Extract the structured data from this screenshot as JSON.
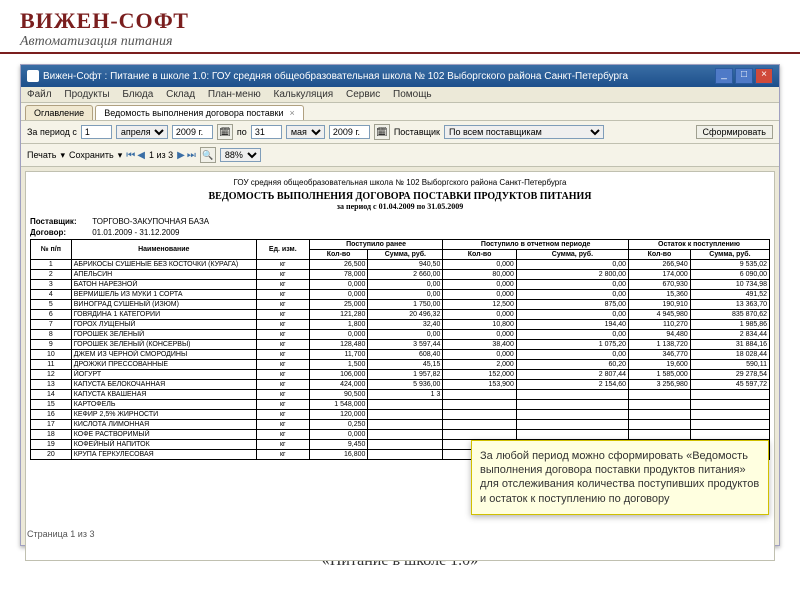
{
  "brand": {
    "title": "ВИЖЕН-СОФТ",
    "subtitle": "Автоматизация питания"
  },
  "window": {
    "title": "Вижен-Софт : Питание в школе 1.0: ГОУ средняя общеобразовательная школа № 102 Выборгского района Санкт-Петербурга"
  },
  "menu": [
    "Файл",
    "Продукты",
    "Блюда",
    "Склад",
    "План-меню",
    "Калькуляция",
    "Сервис",
    "Помощь"
  ],
  "tabs": {
    "first": "Оглавление",
    "second": "Ведомость выполнения договора поставки"
  },
  "period": {
    "label": "За период с",
    "from_day": "1",
    "from_month": "апреля",
    "from_year": "2009 г.",
    "to": "по",
    "to_day": "31",
    "to_month": "мая",
    "to_year": "2009 г."
  },
  "supplier": {
    "label": "Поставщик",
    "value": "По всем поставщикам",
    "button": "Сформировать"
  },
  "toolbar2": {
    "print": "Печать",
    "save": "Сохранить",
    "pages": "1 из 3",
    "zoom": "88%"
  },
  "report": {
    "org": "ГОУ средняя общеобразовательная школа № 102 Выборгского района Санкт-Петербурга",
    "title": "ВЕДОМОСТЬ ВЫПОЛНЕНИЯ ДОГОВОРА ПОСТАВКИ ПРОДУКТОВ ПИТАНИЯ",
    "period_line": "за период с 01.04.2009 по 31.05.2009",
    "supplier_label": "Поставщик:",
    "supplier": "ТОРГОВО-ЗАКУПОЧНАЯ БАЗА",
    "contract_label": "Договор:",
    "contract": "01.01.2009 - 31.12.2009",
    "headers": {
      "num": "№ п/п",
      "name": "Наименование",
      "unit": "Ед. изм.",
      "g1": "Поступило ранее",
      "g2": "Поступило в отчетном периоде",
      "g3": "Остаток к поступлению",
      "qty": "Кол-во",
      "sum": "Сумма, руб."
    },
    "rows": [
      {
        "n": 1,
        "name": "АБРИКОСЫ СУШЕНЫЕ БЕЗ КОСТОЧКИ (КУРАГА)",
        "u": "кг",
        "q1": "26,500",
        "s1": "940,50",
        "q2": "0,000",
        "s2": "0,00",
        "q3": "266,940",
        "s3": "9 535,02"
      },
      {
        "n": 2,
        "name": "АПЕЛЬСИН",
        "u": "кг",
        "q1": "78,000",
        "s1": "2 660,00",
        "q2": "80,000",
        "s2": "2 800,00",
        "q3": "174,000",
        "s3": "6 090,00"
      },
      {
        "n": 3,
        "name": "БАТОН НАРЕЗНОЙ",
        "u": "кг",
        "q1": "0,000",
        "s1": "0,00",
        "q2": "0,000",
        "s2": "0,00",
        "q3": "670,930",
        "s3": "10 734,98"
      },
      {
        "n": 4,
        "name": "ВЕРМИШЕЛЬ ИЗ МУКИ 1 СОРТА",
        "u": "кг",
        "q1": "0,000",
        "s1": "0,00",
        "q2": "0,000",
        "s2": "0,00",
        "q3": "15,360",
        "s3": "491,52"
      },
      {
        "n": 5,
        "name": "ВИНОГРАД СУШЕНЫЙ (ИЗЮМ)",
        "u": "кг",
        "q1": "25,000",
        "s1": "1 750,00",
        "q2": "12,500",
        "s2": "875,00",
        "q3": "190,910",
        "s3": "13 363,70"
      },
      {
        "n": 6,
        "name": "ГОВЯДИНА 1 КАТЕГОРИИ",
        "u": "кг",
        "q1": "121,280",
        "s1": "20 496,32",
        "q2": "0,000",
        "s2": "0,00",
        "q3": "4 945,980",
        "s3": "835 870,62"
      },
      {
        "n": 7,
        "name": "ГОРОХ ЛУЩЕНЫЙ",
        "u": "кг",
        "q1": "1,800",
        "s1": "32,40",
        "q2": "10,800",
        "s2": "194,40",
        "q3": "110,270",
        "s3": "1 985,86"
      },
      {
        "n": 8,
        "name": "ГОРОШЕК ЗЕЛЕНЫЙ",
        "u": "кг",
        "q1": "0,000",
        "s1": "0,00",
        "q2": "0,000",
        "s2": "0,00",
        "q3": "94,480",
        "s3": "2 834,44"
      },
      {
        "n": 9,
        "name": "ГОРОШЕК ЗЕЛЕНЫЙ (КОНСЕРВЫ)",
        "u": "кг",
        "q1": "128,480",
        "s1": "3 597,44",
        "q2": "38,400",
        "s2": "1 075,20",
        "q3": "1 138,720",
        "s3": "31 884,16"
      },
      {
        "n": 10,
        "name": "ДЖЕМ ИЗ ЧЕРНОЙ СМОРОДИНЫ",
        "u": "кг",
        "q1": "11,700",
        "s1": "608,40",
        "q2": "0,000",
        "s2": "0,00",
        "q3": "346,770",
        "s3": "18 028,44"
      },
      {
        "n": 11,
        "name": "ДРОЖЖИ ПРЕССОВАННЫЕ",
        "u": "кг",
        "q1": "1,500",
        "s1": "45,15",
        "q2": "2,000",
        "s2": "60,20",
        "q3": "19,600",
        "s3": "590,11"
      },
      {
        "n": 12,
        "name": "ЙОГУРТ",
        "u": "кг",
        "q1": "106,000",
        "s1": "1 957,82",
        "q2": "152,000",
        "s2": "2 807,44",
        "q3": "1 585,000",
        "s3": "29 278,54"
      },
      {
        "n": 13,
        "name": "КАПУСТА БЕЛОКОЧАННАЯ",
        "u": "кг",
        "q1": "424,000",
        "s1": "5 936,00",
        "q2": "153,900",
        "s2": "2 154,60",
        "q3": "3 256,980",
        "s3": "45 597,72"
      },
      {
        "n": 14,
        "name": "КАПУСТА КВАШЕНАЯ",
        "u": "кг",
        "q1": "90,500",
        "s1": "1 3",
        "q2": "",
        "s2": "",
        "q3": "",
        "s3": ""
      },
      {
        "n": 15,
        "name": "КАРТОФЕЛЬ",
        "u": "кг",
        "q1": "1 548,000",
        "s1": "",
        "q2": "",
        "s2": "",
        "q3": "",
        "s3": ""
      },
      {
        "n": 16,
        "name": "КЕФИР 2,5% ЖИРНОСТИ",
        "u": "кг",
        "q1": "120,000",
        "s1": "",
        "q2": "",
        "s2": "",
        "q3": "",
        "s3": ""
      },
      {
        "n": 17,
        "name": "КИСЛОТА ЛИМОННАЯ",
        "u": "кг",
        "q1": "0,250",
        "s1": "",
        "q2": "",
        "s2": "",
        "q3": "",
        "s3": ""
      },
      {
        "n": 18,
        "name": "КОФЕ РАСТВОРИМЫЙ",
        "u": "кг",
        "q1": "0,000",
        "s1": "",
        "q2": "",
        "s2": "",
        "q3": "",
        "s3": ""
      },
      {
        "n": 19,
        "name": "КОФЕЙНЫЙ НАПИТОК",
        "u": "кг",
        "q1": "9,450",
        "s1": "",
        "q2": "",
        "s2": "",
        "q3": "",
        "s3": ""
      },
      {
        "n": 20,
        "name": "КРУПА ГЕРКУЛЕСОВАЯ",
        "u": "кг",
        "q1": "16,800",
        "s1": "",
        "q2": "",
        "s2": "",
        "q3": "",
        "s3": ""
      }
    ]
  },
  "footer": "Страница 1 из 3",
  "callout": "За любой период можно сформировать «Ведомость выполнения договора поставки продуктов питания» для отслеживания количества поступивших продуктов и остаток к поступлению по договору",
  "caption": "«Питание в школе 1.0»",
  "chart_data": {
    "type": "table",
    "title": "Ведомость выполнения договора поставки продуктов питания",
    "columns": [
      "№",
      "Наименование",
      "Ед.изм.",
      "Поступило ранее кол-во",
      "Поступило ранее сумма",
      "Поступило в отч. периоде кол-во",
      "Поступило в отч. периоде сумма",
      "Остаток кол-во",
      "Остаток сумма"
    ]
  }
}
